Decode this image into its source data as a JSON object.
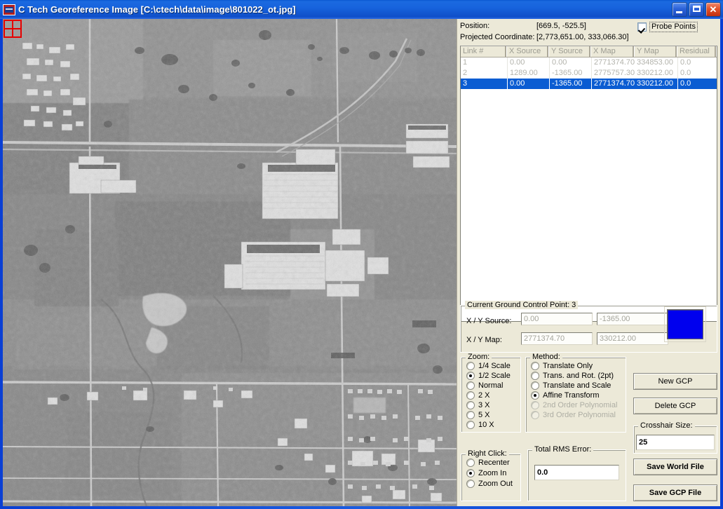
{
  "window": {
    "title": "C Tech Georeference Image [C:\\ctech\\data\\image\\801022_ot.jpg]",
    "minimize_label": "_",
    "maximize_label": "□",
    "close_label": "✕",
    "frame_color": "#0a3fd4",
    "panel_color": "#ece9d8"
  },
  "info": {
    "position_label": "Position:",
    "position_value": "[669.5, -525.5]",
    "projected_label": "Projected Coordinate:",
    "projected_value": "[2,773,651.00, 333,066.30]",
    "probe_points_label": "Probe Points",
    "probe_points_checked": true
  },
  "gcp_table": {
    "columns": [
      "Link #",
      "X Source",
      "Y Source",
      "X Map",
      "Y Map",
      "Residual"
    ],
    "rows": [
      {
        "link": "1",
        "x_source": "0.00",
        "y_source": "0.00",
        "x_map": "2771374.70",
        "y_map": "334853.00",
        "residual": "0.0",
        "selected": false
      },
      {
        "link": "2",
        "x_source": "1289.00",
        "y_source": "-1365.00",
        "x_map": "2775757.30",
        "y_map": "330212.00",
        "residual": "0.0",
        "selected": false
      },
      {
        "link": "3",
        "x_source": "0.00",
        "y_source": "-1365.00",
        "x_map": "2771374.70",
        "y_map": "330212.00",
        "residual": "0.0",
        "selected": true
      }
    ]
  },
  "current_gcp": {
    "caption": "Current Ground Control Point: 3",
    "source_label": "X / Y Source:",
    "source_x": "0.00",
    "source_y": "-1365.00",
    "map_label": "X / Y Map:",
    "map_x": "2771374.70",
    "map_y": "330212.00",
    "swatch_color": "#0000ee"
  },
  "zoom_group": {
    "caption": "Zoom:",
    "options": [
      "1/4 Scale",
      "1/2 Scale",
      "Normal",
      "2 X",
      "3 X",
      "5 X",
      "10 X"
    ],
    "selected": "1/2 Scale"
  },
  "method_group": {
    "caption": "Method:",
    "options": [
      {
        "label": "Translate Only",
        "enabled": true
      },
      {
        "label": "Trans. and Rot. (2pt)",
        "enabled": true
      },
      {
        "label": "Translate and Scale",
        "enabled": true
      },
      {
        "label": "Affine Transform",
        "enabled": true
      },
      {
        "label": "2nd Order Polynomial",
        "enabled": false
      },
      {
        "label": "3rd Order Polynomial",
        "enabled": false
      }
    ],
    "selected": "Affine Transform"
  },
  "rightclick_group": {
    "caption": "Right Click:",
    "options": [
      "Recenter",
      "Zoom In",
      "Zoom Out"
    ],
    "selected": "Zoom In"
  },
  "rms_group": {
    "caption": "Total RMS Error:",
    "value": "0.0"
  },
  "crosshair_group": {
    "caption": "Crosshair Size:",
    "value": "25"
  },
  "buttons": {
    "new_gcp": "New GCP",
    "delete_gcp": "Delete GCP",
    "save_world_file": "Save World File",
    "save_gcp_file": "Save GCP File"
  }
}
